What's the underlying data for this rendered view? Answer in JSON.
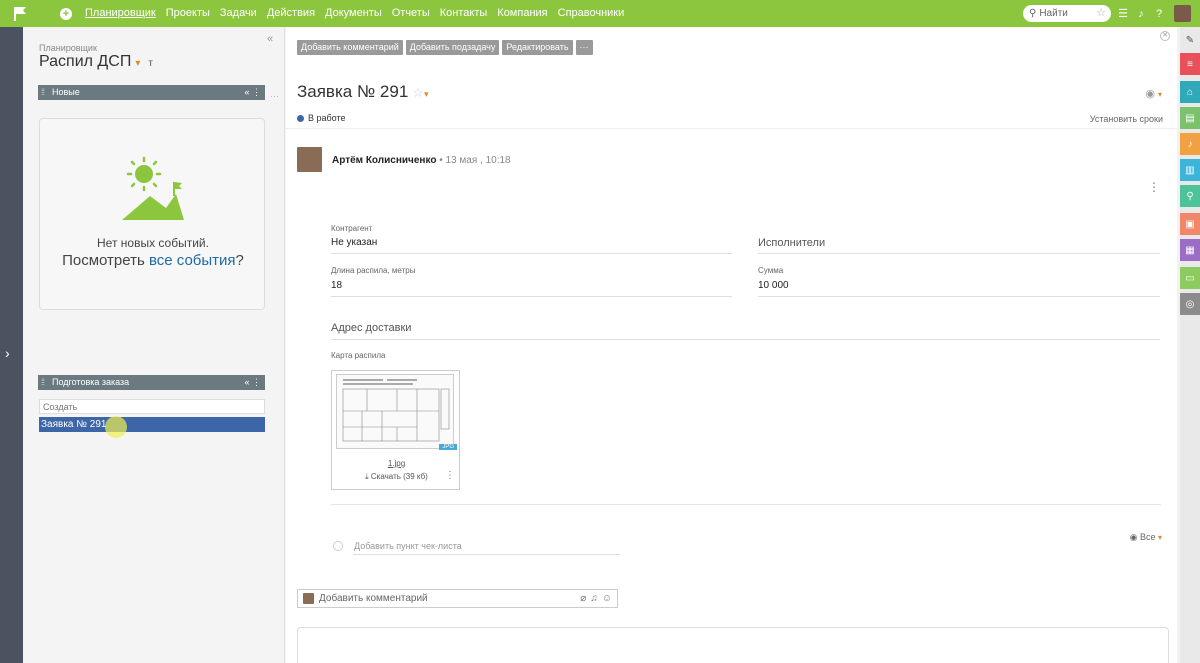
{
  "topbar": {
    "nav": [
      "Планировщик",
      "Проекты",
      "Задачи",
      "Действия",
      "Документы",
      "Отчеты",
      "Контакты",
      "Компания",
      "Справочники"
    ],
    "search_placeholder": "Найти"
  },
  "planner": {
    "subtitle": "Планировщик",
    "title": "Распил ДСП",
    "title_marker": "т",
    "groups": [
      {
        "name": "Новые",
        "empty_line1": "Нет новых событий.",
        "empty_prefix": "Посмотреть ",
        "empty_link": "все события",
        "empty_suffix": "?"
      },
      {
        "name": "Подготовка заказа",
        "create_placeholder": "Создать",
        "tasks": [
          "Заявка № 291"
        ]
      }
    ]
  },
  "toolbar": {
    "add_comment": "Добавить комментарий",
    "add_subtask": "Добавить подзадачу",
    "edit": "Редактировать",
    "more": "···"
  },
  "task": {
    "title": "Заявка № 291",
    "status": "В работе",
    "set_deadlines": "Установить сроки",
    "author": "Артём Колисниченко",
    "date": "13 мая , 10:18",
    "fields": {
      "counterparty_label": "Контрагент",
      "counterparty_value": "Не указан",
      "executors_heading": "Исполнители",
      "length_label": "Длина распила, метры",
      "length_value": "18",
      "sum_label": "Сумма",
      "sum_value": "10 000",
      "address_heading": "Адрес доставки",
      "map_label": "Карта распила"
    },
    "attachment": {
      "filename": "1.jpg",
      "ext_badge": "JPG",
      "download": "Скачать (39 кб)"
    },
    "view_filter": "Все",
    "checklist_placeholder": "Добавить пункт чек-листа",
    "comment_placeholder": "Добавить комментарий"
  },
  "colors": {
    "topbar": "#8cc63f",
    "accent_orange": "#e08a2e",
    "selected_row": "#3d66a8",
    "group_header": "#6b7a80",
    "right_strip": [
      "#4b5360",
      "#e8515a",
      "#2fa8b8",
      "#7cc16c",
      "#f0a243",
      "#3db5d8",
      "#4ec39a",
      "#f0866a",
      "#9b6dc5",
      "#8ccc5e",
      "#8c8c8c"
    ]
  }
}
